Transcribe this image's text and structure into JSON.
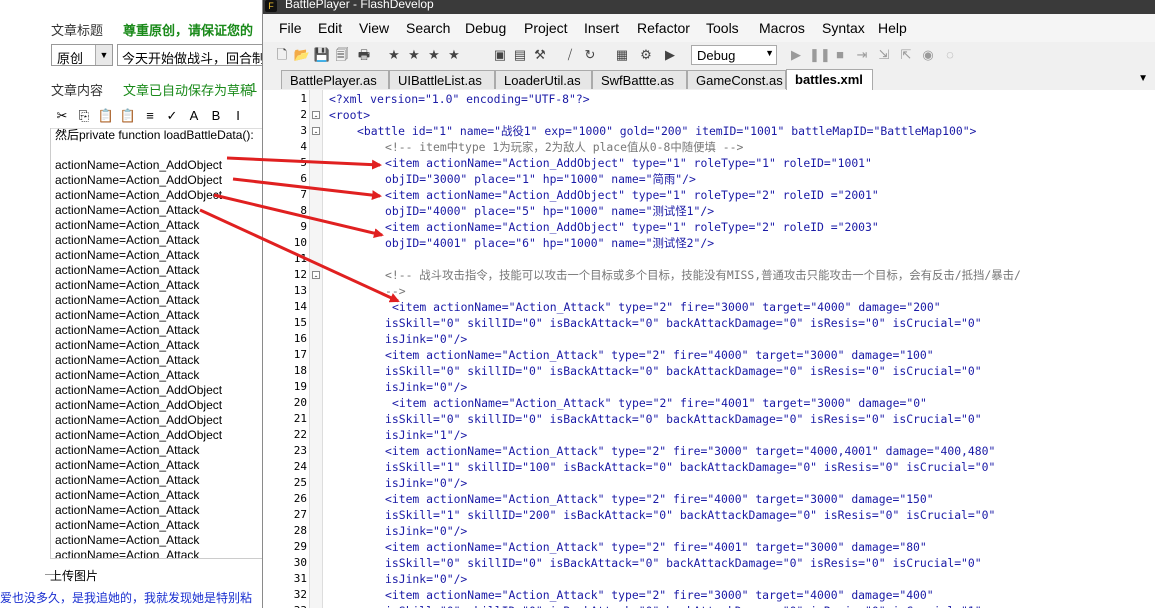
{
  "background_editor": {
    "title_label": "文章标题",
    "respect_notice": "尊重原创，请保证您的",
    "type_select_value": "原创",
    "title_input_value": "今天开始做战斗，回合制",
    "content_label": "文章内容",
    "autosave_notice": "文章已自动保存为草稿",
    "autosave_time": "1",
    "toolbar_icons": [
      "cut-icon",
      "copy-icon",
      "paste-icon",
      "paste-text-icon",
      "format-icon",
      "spellcheck-icon",
      "font-icon",
      "bold-icon",
      "italic-icon"
    ],
    "toolbar_glyphs": [
      "✂",
      "⎘",
      "📋",
      "📋",
      "≡",
      "✓",
      "A",
      "B",
      "I"
    ],
    "editor_lines": [
      "然后private function loadBattleData():",
      "",
      "actionName=Action_AddObject",
      "actionName=Action_AddObject",
      "actionName=Action_AddObject",
      "actionName=Action_Attack",
      "actionName=Action_Attack",
      "actionName=Action_Attack",
      "actionName=Action_Attack",
      "actionName=Action_Attack",
      "actionName=Action_Attack",
      "actionName=Action_Attack",
      "actionName=Action_Attack",
      "actionName=Action_Attack",
      "actionName=Action_Attack",
      "actionName=Action_Attack",
      "actionName=Action_Attack",
      "actionName=Action_AddObject",
      "actionName=Action_AddObject",
      "actionName=Action_AddObject",
      "actionName=Action_AddObject",
      "actionName=Action_Attack",
      "actionName=Action_Attack",
      "actionName=Action_Attack",
      "actionName=Action_Attack",
      "actionName=Action_Attack",
      "actionName=Action_Attack",
      "actionName=Action_Attack",
      "actionName=Action_Attack"
    ],
    "upload_label": "上传图片",
    "bottom_text": "爱也没多久，是我追她的，我就发现她是特别粘"
  },
  "window": {
    "title": "BattlePlayer - FlashDevelop",
    "menu": [
      "File",
      "Edit",
      "View",
      "Search",
      "Debug",
      "Project",
      "Insert",
      "Refactor",
      "Tools",
      "Macros",
      "Syntax",
      "Help"
    ],
    "build_config": "Debug",
    "toolbar_icons": [
      "new-file-icon",
      "open-icon",
      "save-icon",
      "save-all-icon",
      "print-icon",
      "bookmark-icon",
      "bookmark-next-icon",
      "bookmark-prev-icon",
      "bookmark-clear-icon",
      "console-icon",
      "layout-icon",
      "build-icon",
      "comment-icon",
      "refresh-icon",
      "package-icon",
      "settings-icon",
      "run-icon"
    ],
    "toolbar_glyphs": [
      "🗋",
      "📂",
      "💾",
      "🗐",
      "🖶",
      "★",
      "★",
      "★",
      "★",
      "▣",
      "▤",
      "⚒",
      "⧸",
      "↻",
      "▦",
      "⚙",
      "▶"
    ],
    "tabs": [
      {
        "label": "BattlePlayer.as",
        "active": false
      },
      {
        "label": "UIBattleList.as",
        "active": false
      },
      {
        "label": "LoaderUtil.as",
        "active": false
      },
      {
        "label": "SwfBattte.as",
        "active": false
      },
      {
        "label": "GameConst.as",
        "active": false
      },
      {
        "label": "battles.xml",
        "active": true
      }
    ],
    "code_lines": [
      {
        "n": "1",
        "text": "<?xml version=\"1.0\" encoding=\"UTF-8\"?>",
        "indent": 0,
        "fold": "",
        "comment": false
      },
      {
        "n": "2",
        "text": "<root>",
        "indent": 0,
        "fold": "-",
        "comment": false
      },
      {
        "n": "3",
        "text": "<battle id=\"1\" name=\"战役1\" exp=\"1000\" gold=\"200\" itemID=\"1001\" battleMapID=\"BattleMap100\">",
        "indent": 4,
        "fold": "-",
        "comment": false
      },
      {
        "n": "4",
        "text": "<!-- item中type 1为玩家，2为敌人 place值从0-8中随便填 -->",
        "indent": 8,
        "fold": "",
        "comment": true
      },
      {
        "n": "5",
        "text": "<item actionName=\"Action_AddObject\" type=\"1\" roleType=\"1\" roleID=\"1001\"",
        "indent": 8,
        "fold": "",
        "comment": false
      },
      {
        "n": "6",
        "text": "objID=\"3000\" place=\"1\" hp=\"1000\" name=\"简雨\"/>",
        "indent": 8,
        "fold": "",
        "comment": false
      },
      {
        "n": "7",
        "text": "<item actionName=\"Action_AddObject\" type=\"1\" roleType=\"2\" roleID =\"2001\"",
        "indent": 8,
        "fold": "",
        "comment": false
      },
      {
        "n": "8",
        "text": "objID=\"4000\" place=\"5\" hp=\"1000\" name=\"测试怪1\"/>",
        "indent": 8,
        "fold": "",
        "comment": false
      },
      {
        "n": "9",
        "text": "<item actionName=\"Action_AddObject\" type=\"1\" roleType=\"2\" roleID =\"2003\"",
        "indent": 8,
        "fold": "",
        "comment": false
      },
      {
        "n": "10",
        "text": "objID=\"4001\" place=\"6\" hp=\"1000\" name=\"测试怪2\"/>",
        "indent": 8,
        "fold": "",
        "comment": false
      },
      {
        "n": "11",
        "text": "",
        "indent": 8,
        "fold": "",
        "comment": false
      },
      {
        "n": "12",
        "text": "<!-- 战斗攻击指令，技能可以攻击一个目标或多个目标，技能没有MISS,普通攻击只能攻击一个目标，会有反击/抵挡/暴击/",
        "indent": 8,
        "fold": "-",
        "comment": true
      },
      {
        "n": "13",
        "text": "-->",
        "indent": 8,
        "fold": "",
        "comment": true
      },
      {
        "n": "14",
        "text": "<item actionName=\"Action_Attack\" type=\"2\" fire=\"3000\" target=\"4000\" damage=\"200\"",
        "indent": 9,
        "fold": "",
        "comment": false
      },
      {
        "n": "15",
        "text": "isSkill=\"0\" skillID=\"0\" isBackAttack=\"0\" backAttackDamage=\"0\" isResis=\"0\" isCrucial=\"0\"",
        "indent": 8,
        "fold": "",
        "comment": false
      },
      {
        "n": "16",
        "text": "isJink=\"0\"/>",
        "indent": 8,
        "fold": "",
        "comment": false
      },
      {
        "n": "17",
        "text": "<item actionName=\"Action_Attack\" type=\"2\" fire=\"4000\" target=\"3000\" damage=\"100\"",
        "indent": 8,
        "fold": "",
        "comment": false
      },
      {
        "n": "18",
        "text": "isSkill=\"0\" skillID=\"0\" isBackAttack=\"0\" backAttackDamage=\"0\" isResis=\"0\" isCrucial=\"0\"",
        "indent": 8,
        "fold": "",
        "comment": false
      },
      {
        "n": "19",
        "text": "isJink=\"0\"/>",
        "indent": 8,
        "fold": "",
        "comment": false
      },
      {
        "n": "20",
        "text": "<item actionName=\"Action_Attack\" type=\"2\" fire=\"4001\" target=\"3000\" damage=\"0\"",
        "indent": 9,
        "fold": "",
        "comment": false
      },
      {
        "n": "21",
        "text": "isSkill=\"0\" skillID=\"0\" isBackAttack=\"0\" backAttackDamage=\"0\" isResis=\"0\" isCrucial=\"0\"",
        "indent": 8,
        "fold": "",
        "comment": false
      },
      {
        "n": "22",
        "text": "isJink=\"1\"/>",
        "indent": 8,
        "fold": "",
        "comment": false
      },
      {
        "n": "23",
        "text": "<item actionName=\"Action_Attack\" type=\"2\" fire=\"3000\" target=\"4000,4001\" damage=\"400,480\"",
        "indent": 8,
        "fold": "",
        "comment": false
      },
      {
        "n": "24",
        "text": "isSkill=\"1\" skillID=\"100\" isBackAttack=\"0\" backAttackDamage=\"0\" isResis=\"0\" isCrucial=\"0\"",
        "indent": 8,
        "fold": "",
        "comment": false
      },
      {
        "n": "25",
        "text": "isJink=\"0\"/>",
        "indent": 8,
        "fold": "",
        "comment": false
      },
      {
        "n": "26",
        "text": "<item actionName=\"Action_Attack\" type=\"2\" fire=\"4000\" target=\"3000\" damage=\"150\"",
        "indent": 8,
        "fold": "",
        "comment": false
      },
      {
        "n": "27",
        "text": "isSkill=\"1\" skillID=\"200\" isBackAttack=\"0\" backAttackDamage=\"0\" isResis=\"0\" isCrucial=\"0\"",
        "indent": 8,
        "fold": "",
        "comment": false
      },
      {
        "n": "28",
        "text": "isJink=\"0\"/>",
        "indent": 8,
        "fold": "",
        "comment": false
      },
      {
        "n": "29",
        "text": "<item actionName=\"Action_Attack\" type=\"2\" fire=\"4001\" target=\"3000\" damage=\"80\"",
        "indent": 8,
        "fold": "",
        "comment": false
      },
      {
        "n": "30",
        "text": "isSkill=\"0\" skillID=\"0\" isBackAttack=\"0\" backAttackDamage=\"0\" isResis=\"0\" isCrucial=\"0\"",
        "indent": 8,
        "fold": "",
        "comment": false
      },
      {
        "n": "31",
        "text": "isJink=\"0\"/>",
        "indent": 8,
        "fold": "",
        "comment": false
      },
      {
        "n": "32",
        "text": "<item actionName=\"Action_Attack\" type=\"2\" fire=\"3000\" target=\"4000\" damage=\"400\"",
        "indent": 8,
        "fold": "",
        "comment": false
      },
      {
        "n": "33",
        "text": "isSkill=\"0\" skillID=\"0\" isBackAttack=\"0\" backAttackDamage=\"0\" isResis=\"0\" isCrucial=\"1\"",
        "indent": 8,
        "fold": "",
        "comment": false
      }
    ]
  },
  "colors": {
    "arrow": "#e02020",
    "xml_text": "#1a1aa6",
    "comment_text": "#777777",
    "notice_green": "#1a8a1a",
    "bottom_link": "#1a2fd0"
  }
}
